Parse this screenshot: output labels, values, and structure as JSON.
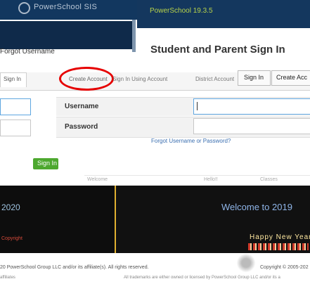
{
  "header": {
    "brand": "PowerSchool SIS",
    "version": "PowerSchool 19.3.5"
  },
  "main": {
    "forgot_left": "Forgot Username",
    "title": "Student and Parent Sign In",
    "tabs": [
      {
        "label": "Sign In"
      },
      {
        "label": "Create Account"
      },
      {
        "label": "Sign In Using Account"
      },
      {
        "label": "District Account"
      }
    ],
    "top_buttons": {
      "sign_in": "Sign In",
      "create": "Create Acc"
    },
    "form": {
      "username_label": "Username",
      "password_label": "Password",
      "username_value": "",
      "password_value": "",
      "forgot_link": "Forgot Username or Password?",
      "submit_label": "Sign In"
    },
    "faint_row": [
      "Welcome",
      "Hello!!",
      "Classes"
    ]
  },
  "panels": {
    "left_year": "2020",
    "left_line": "Copyright",
    "right_welcome": "Welcome to 2019",
    "right_stripe": "Happy New Year"
  },
  "footer": {
    "left": "20 PowerSchool Group LLC and/or its affiliate(s). All rights reserved.",
    "right": "Copyright © 2005-202",
    "bottom": "All trademarks are either owned or licensed by PowerSchool Group LLC and/or its a",
    "bottom_left": "affiliates"
  },
  "colors": {
    "header": "#12375f",
    "accent_green": "#4da82f",
    "highlight_oval": "#e60000",
    "link": "#3b6fb0"
  }
}
